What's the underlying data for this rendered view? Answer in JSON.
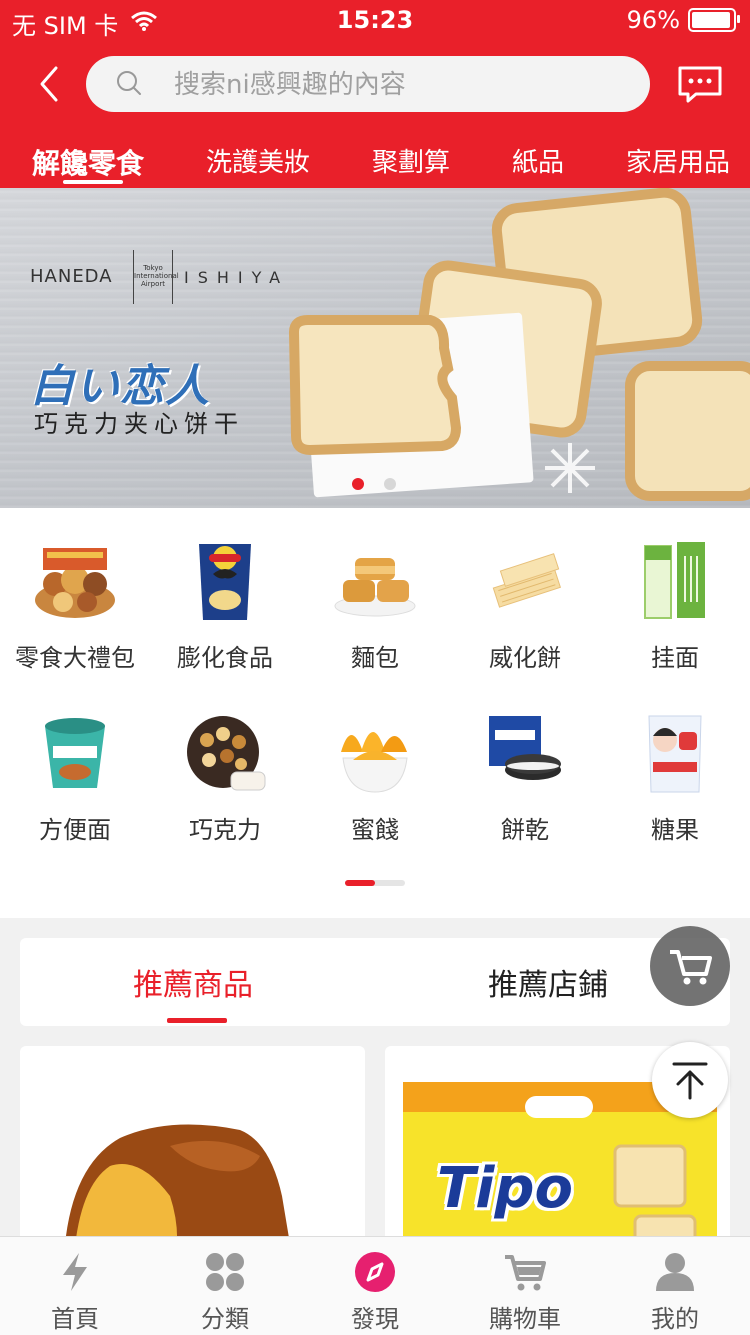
{
  "status_bar": {
    "carrier": "无 SIM 卡",
    "time": "15:23",
    "battery": "96%"
  },
  "search": {
    "placeholder": "搜索ni感興趣的內容"
  },
  "categories": [
    "解饞零食",
    "洗護美妝",
    "聚劃算",
    "紙品",
    "家居用品"
  ],
  "banner": {
    "brand_left": "HANEDA",
    "brand_airport": "Tokyo International Airport",
    "brand_right": "ISHIYA",
    "title": "白い恋人",
    "subtitle": "巧克力夹心饼干",
    "page_count": 2,
    "active_page": 1
  },
  "grid_items": [
    {
      "label": "零食大禮包",
      "icon": "snack-pack-icon"
    },
    {
      "label": "膨化食品",
      "icon": "chips-bag-icon"
    },
    {
      "label": "麵包",
      "icon": "bread-icon"
    },
    {
      "label": "威化餅",
      "icon": "wafer-icon"
    },
    {
      "label": "挂面",
      "icon": "noodle-pack-icon"
    },
    {
      "label": "方便面",
      "icon": "instant-noodle-icon"
    },
    {
      "label": "巧克力",
      "icon": "chocolate-tin-icon"
    },
    {
      "label": "蜜餞",
      "icon": "dried-mango-icon"
    },
    {
      "label": "餅乾",
      "icon": "cookie-icon"
    },
    {
      "label": "糖果",
      "icon": "candy-bag-icon"
    }
  ],
  "recommend_tabs": [
    "推薦商品",
    "推薦店鋪"
  ],
  "products": [
    {
      "icon": "bread-product-image"
    },
    {
      "brand": "Tipo"
    }
  ],
  "bottom_nav": [
    "首頁",
    "分類",
    "發現",
    "購物車",
    "我的"
  ],
  "colors": {
    "accent": "#e9202a",
    "active_tab": "#e9202a"
  }
}
